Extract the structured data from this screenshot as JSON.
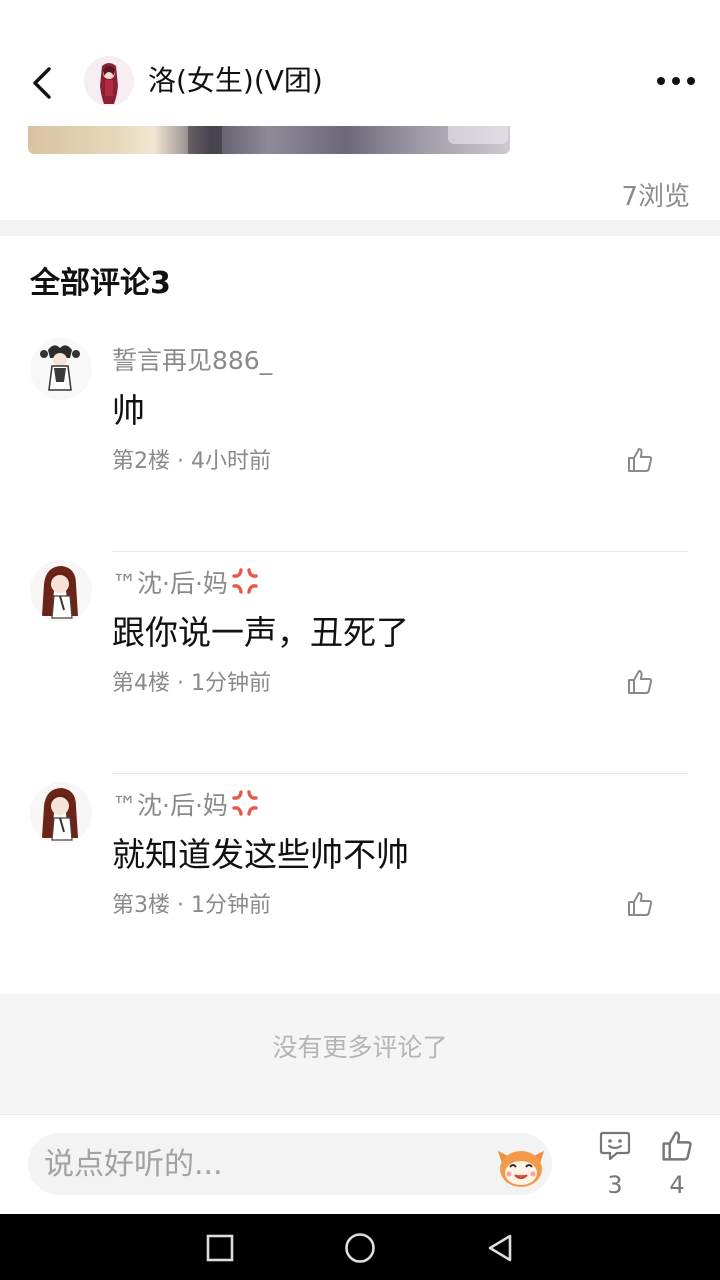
{
  "header": {
    "author_name": "洛(女生)(V团)"
  },
  "post": {
    "views": "7浏览"
  },
  "comments_section": {
    "title": "全部评论3",
    "items": [
      {
        "user": "誓言再见886_",
        "text": "帅",
        "meta": "第2楼 · 4小时前",
        "badge": ""
      },
      {
        "user": "™沈·后·妈",
        "text": "跟你说一声，丑死了",
        "meta": "第4楼 · 1分钟前",
        "badge": "anger-icon"
      },
      {
        "user": "™沈·后·妈",
        "text": "就知道发这些帅不帅",
        "meta": "第3楼 · 1分钟前",
        "badge": "anger-icon"
      }
    ],
    "no_more": "没有更多评论了"
  },
  "bottom_bar": {
    "input_placeholder": "说点好听的...",
    "comment_count": "3",
    "like_count": "4"
  },
  "colors": {
    "primary_text": "#111111",
    "secondary_text": "#8a8a8a",
    "divider": "#f3f3f3"
  }
}
